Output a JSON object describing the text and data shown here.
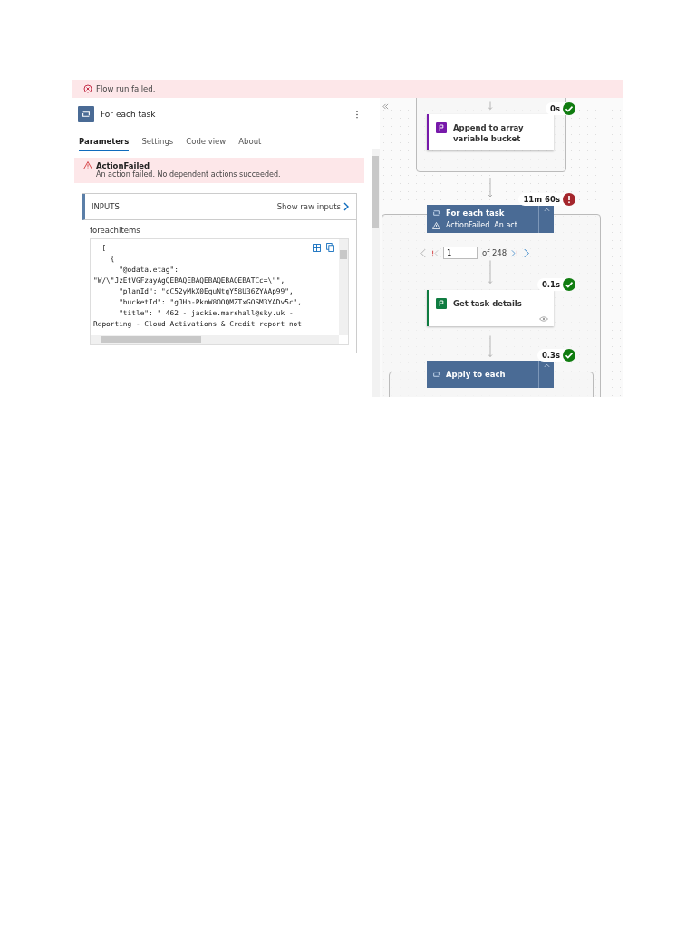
{
  "banner": {
    "text": "Flow run failed."
  },
  "panel": {
    "title": "For each task",
    "tabs": [
      {
        "label": "Parameters",
        "selected": true
      },
      {
        "label": "Settings",
        "selected": false
      },
      {
        "label": "Code view",
        "selected": false
      },
      {
        "label": "About",
        "selected": false
      }
    ],
    "error": {
      "title": "ActionFailed",
      "message": "An action failed. No dependent actions succeeded."
    },
    "inputs": {
      "heading": "INPUTS",
      "raw_link": "Show raw inputs",
      "field_label": "foreachItems",
      "code_lines": [
        "  [",
        "    {",
        "      \"@odata.etag\":",
        "\"W/\\\"JzEtVGFzayAgQEBAQEBAQEBAQEBAQEBATCc=\\\"\",",
        "      \"planId\": \"cC52yMkX0EquNtgY58U36ZYAAp99\",",
        "      \"bucketId\": \"gJHn-PknW8OOQMZTxGOSM3YADv5c\",",
        "      \"title\": \" 462 - jackie.marshall@sky.uk -",
        "Reporting - Cloud Activations & Credit report not"
      ]
    }
  },
  "flow": {
    "nodes": [
      {
        "kind": "action",
        "title": "Append to array variable bucket",
        "duration": "0s",
        "succeeded": true,
        "color": "#7719aa"
      },
      {
        "kind": "loop",
        "title": "For each task",
        "message": "ActionFailed. An act...",
        "duration": "11m 60s",
        "succeeded": false,
        "expanded": true,
        "pager": {
          "value": "1",
          "total": "of 248"
        }
      },
      {
        "kind": "action",
        "title": "Get task details",
        "duration": "0.1s",
        "succeeded": true,
        "color": "#107c41"
      },
      {
        "kind": "loop",
        "title": "Apply to each",
        "duration": "0.3s",
        "succeeded": true,
        "expanded": true
      }
    ]
  }
}
